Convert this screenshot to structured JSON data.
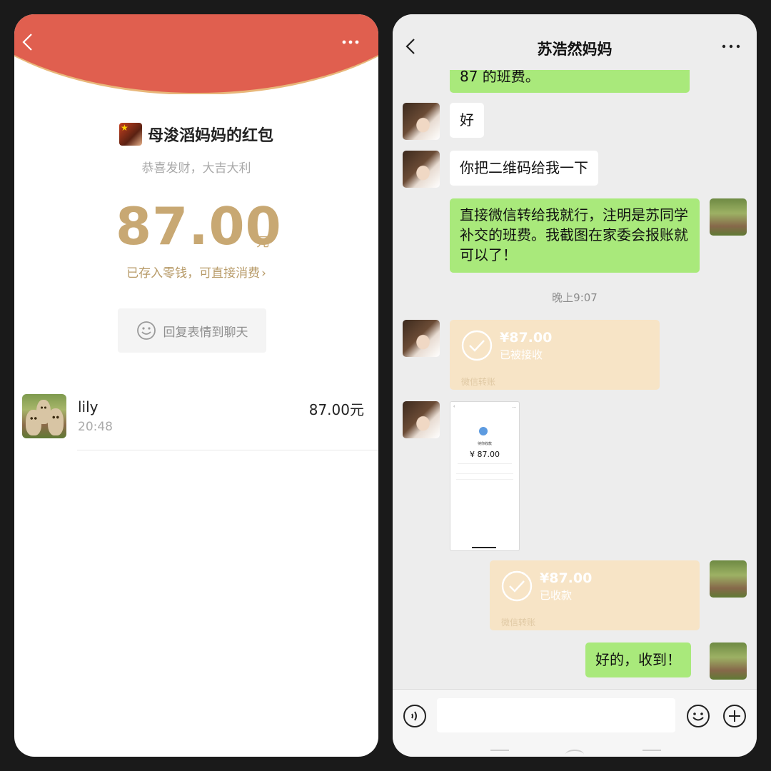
{
  "red_packet": {
    "sender_name": "母浚滔妈妈的红包",
    "wish": "恭喜发财，大吉大利",
    "amount": "87.00",
    "unit": "元",
    "saved_note": "已存入零钱，可直接消费",
    "reply_label": "回复表情到聊天",
    "receiver": {
      "name": "lily",
      "time": "20:48",
      "amount": "87.00元"
    }
  },
  "chat": {
    "title": "苏浩然妈妈",
    "messages": {
      "m0": "87 的班费。",
      "m1": "好",
      "m2": "你把二维码给我一下",
      "m3": "直接微信转给我就行，注明是苏同学补交的班费。我截图在家委会报账就可以了！",
      "timestamp": "晚上9:07",
      "t1_amount": "¥87.00",
      "t1_status": "已被接收",
      "t1_footer": "微信转账",
      "shot_label": "待你收款",
      "shot_amount": "¥ 87.00",
      "t2_amount": "¥87.00",
      "t2_status": "已收款",
      "t2_footer": "微信转账",
      "m4": "好的，收到！"
    }
  },
  "colors": {
    "header_red": "#e05f4f",
    "gold": "#c8a873",
    "bubble_green": "#a9e97b",
    "transfer_bg": "#f7e4c6"
  }
}
